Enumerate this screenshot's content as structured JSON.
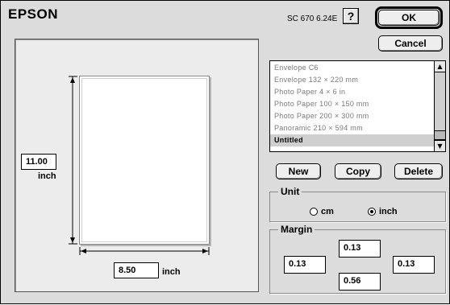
{
  "header": {
    "brand": "EPSON",
    "version": "SC 670 6.24E",
    "help_label": "?"
  },
  "buttons": {
    "ok": "OK",
    "cancel": "Cancel",
    "new": "New",
    "copy": "Copy",
    "delete": "Delete"
  },
  "paper_list": {
    "items": [
      "Envelope C6",
      "Envelope 132 × 220 mm",
      "Photo Paper 4 × 6 in",
      "Photo Paper 100 × 150 mm",
      "Photo Paper 200 × 300 mm",
      "Panoramic 210 × 594 mm",
      "Untitled"
    ],
    "selected": "Untitled"
  },
  "preview": {
    "height_value": "11.00",
    "height_unit": "inch",
    "width_value": "8.50",
    "width_unit": "inch"
  },
  "unit_group": {
    "title": "Unit",
    "options": [
      "cm",
      "inch"
    ],
    "selected": "inch"
  },
  "margin_group": {
    "title": "Margin",
    "top": "0.13",
    "left": "0.13",
    "right": "0.13",
    "bottom": "0.56"
  },
  "colors": {
    "dialog_bg": "#dcdcdc",
    "preview_bg": "#ececec",
    "list_dim_text": "#7a7a7a"
  }
}
